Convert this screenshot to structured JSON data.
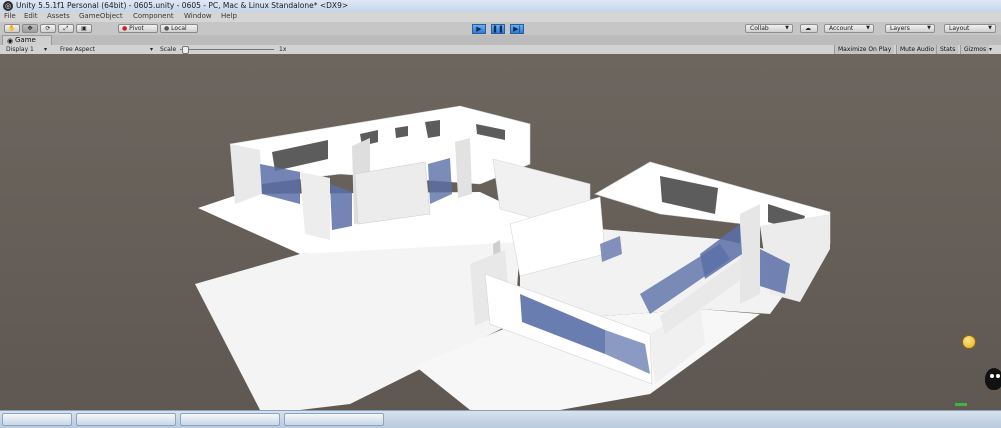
{
  "window": {
    "title": "Unity 5.5.1f1 Personal (64bit) - 0605.unity - 0605 - PC, Mac & Linux Standalone* <DX9>"
  },
  "menu": [
    "File",
    "Edit",
    "Assets",
    "GameObject",
    "Component",
    "Window",
    "Help"
  ],
  "toolbar": {
    "pivot_label": "Pivot",
    "local_label": "Local",
    "collab_label": "Collab",
    "account_label": "Account",
    "layers_label": "Layers",
    "layout_label": "Layout"
  },
  "game_tab": {
    "label": "Game"
  },
  "game_toolbar": {
    "display": "Display 1",
    "aspect": "Free Aspect",
    "scale_label": "Scale",
    "scale_value": "1x",
    "maximize_on_play": "Maximize On Play",
    "mute_audio": "Mute Audio",
    "stats": "Stats",
    "gizmos": "Gizmos"
  },
  "colors": {
    "play_accent": "#2f7ed9",
    "viewport_bg": "#655e58",
    "wall": "#ffffff",
    "shadow": "#5a6fa8"
  },
  "icons": {
    "hand_tool": "hand-icon",
    "move_tool": "move-icon",
    "rotate_tool": "rotate-icon",
    "scale_tool": "scale-icon",
    "rect_tool": "rect-icon",
    "play": "play-icon",
    "pause": "pause-icon",
    "step": "step-icon",
    "cloud": "cloud-icon"
  }
}
